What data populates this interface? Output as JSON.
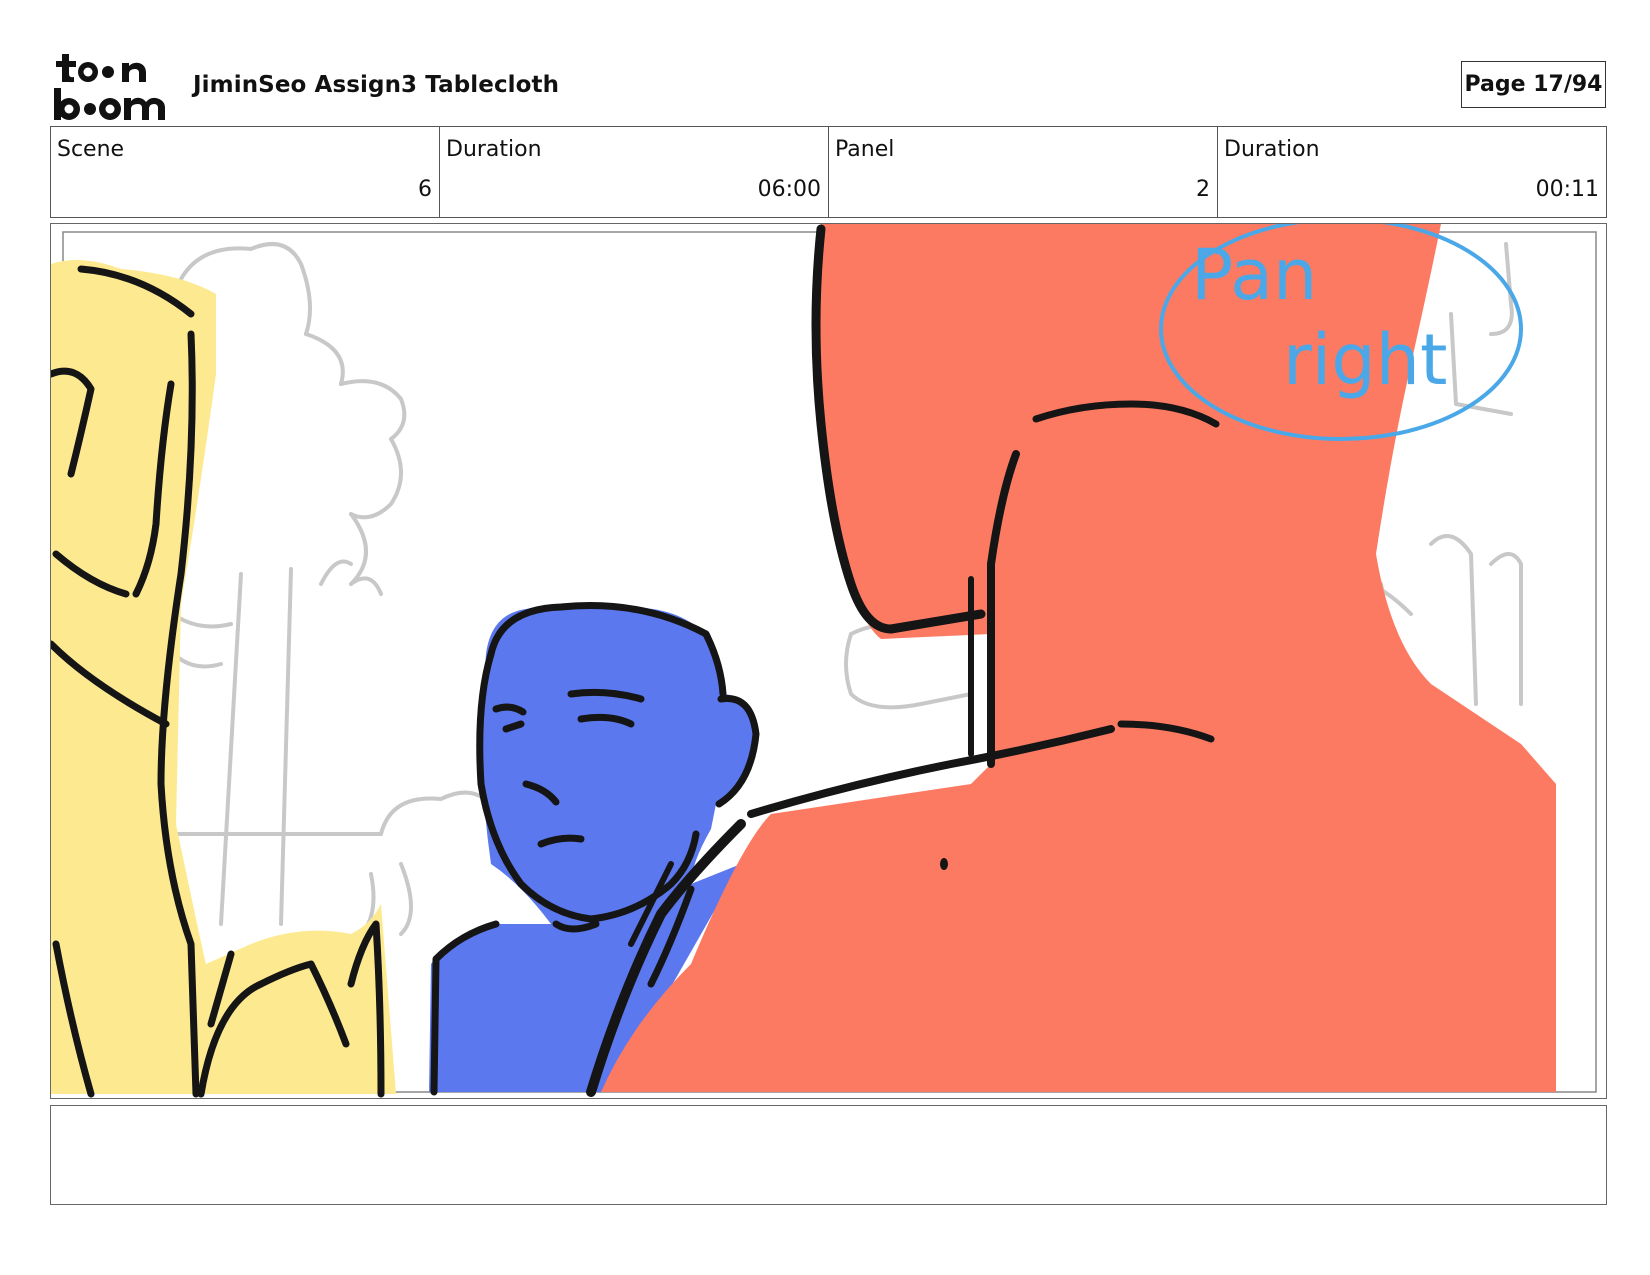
{
  "header": {
    "logo_text": "toon boom",
    "document_title": "JiminSeo Assign3 Tablecloth",
    "page_label": "Page 17/94"
  },
  "info": {
    "scene_label": "Scene",
    "scene_value": "6",
    "scene_duration_label": "Duration",
    "scene_duration_value": "06:00",
    "panel_label": "Panel",
    "panel_value": "2",
    "panel_duration_label": "Duration",
    "panel_duration_value": "00:11"
  },
  "panel_drawing": {
    "annotation_line1": "Pan",
    "annotation_line2": "right",
    "colors": {
      "yellow_figure": "#fde98f",
      "blue_character": "#5b78ee",
      "red_character": "#fd7a62",
      "annotation": "#4aa8e8",
      "sketch_lines": "#c8c8c8",
      "ink": "#151515"
    }
  },
  "notes": {
    "text": ""
  }
}
